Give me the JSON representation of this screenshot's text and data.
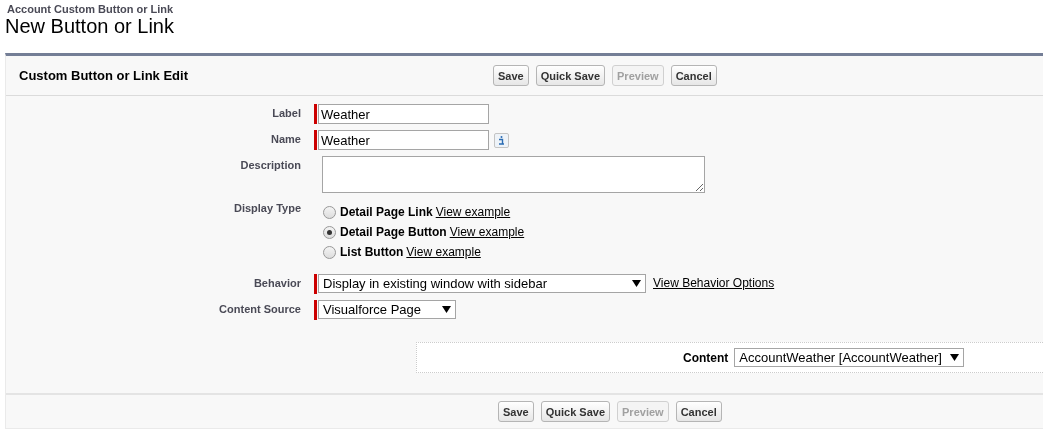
{
  "breadcrumb": "Account Custom Button or Link",
  "page_title": "New Button or Link",
  "section": {
    "title": "Custom Button or Link Edit"
  },
  "top_buttons": [
    {
      "label": "Save",
      "disabled": false
    },
    {
      "label": "Quick Save",
      "disabled": false
    },
    {
      "label": "Preview",
      "disabled": true
    },
    {
      "label": "Cancel",
      "disabled": false
    }
  ],
  "fields": [
    {
      "kind": "text",
      "label": "Label",
      "value": "Weather",
      "required": true
    },
    {
      "kind": "text",
      "label": "Name",
      "value": "Weather",
      "required": true,
      "info": true
    },
    {
      "kind": "textarea",
      "label": "Description",
      "required": false
    },
    {
      "kind": "radio",
      "label": "Display Type",
      "options": [
        {
          "label": "Detail Page Link",
          "link": "View example",
          "selected": false
        },
        {
          "label": "Detail Page Button",
          "link": "View example",
          "selected": true
        },
        {
          "label": "List Button",
          "link": "View example",
          "selected": false
        }
      ]
    },
    {
      "kind": "select",
      "label": "Behavior",
      "value": "Display in existing window with sidebar",
      "required": true,
      "link": "View Behavior Options",
      "wide": true
    },
    {
      "kind": "select",
      "label": "Content Source",
      "value": "Visualforce Page",
      "required": true,
      "wide": false
    }
  ],
  "content": {
    "label": "Content",
    "value": "AccountWeather [AccountWeather]"
  },
  "bottom_buttons": [
    {
      "label": "Save",
      "disabled": false
    },
    {
      "label": "Quick Save",
      "disabled": false
    },
    {
      "label": "Preview",
      "disabled": true
    },
    {
      "label": "Cancel",
      "disabled": false
    }
  ]
}
